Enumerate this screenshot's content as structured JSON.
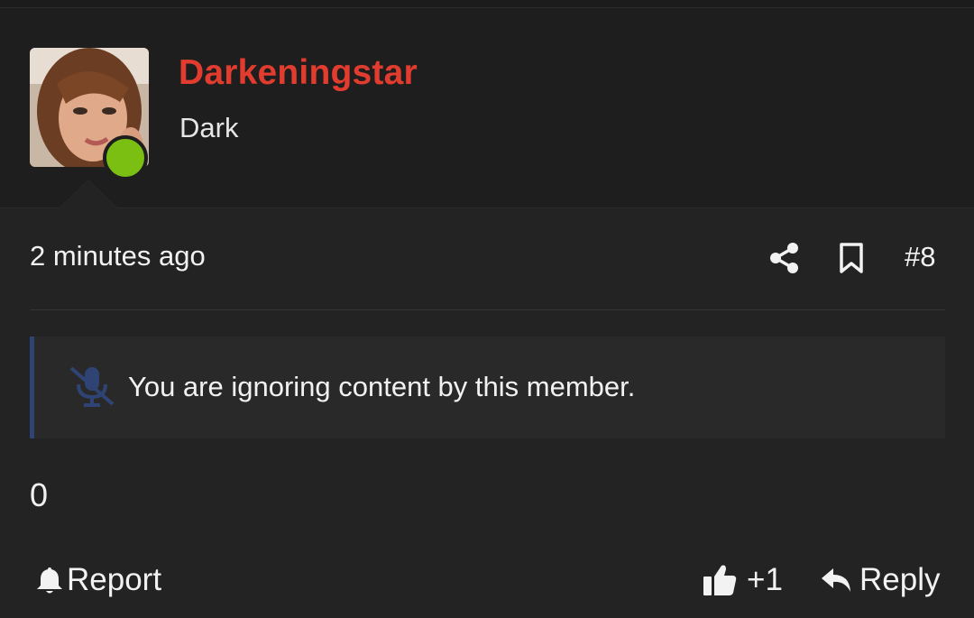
{
  "user": {
    "name": "Darkeningstar",
    "title": "Dark",
    "status": "online"
  },
  "post": {
    "time": "2 minutes ago",
    "number": "#8",
    "ignored_notice": "You are ignoring content by this member.",
    "reaction_score": "0"
  },
  "actions": {
    "report_label": "Report",
    "like_label": "+1",
    "reply_label": "Reply"
  },
  "icons": {
    "share": "share-icon",
    "bookmark": "bookmark-icon",
    "mute": "microphone-slash-icon",
    "report": "bell-icon",
    "like": "thumbs-up-icon",
    "reply": "reply-arrow-icon"
  },
  "colors": {
    "username": "#e23c2f",
    "online": "#7bbf12",
    "ignored_accent": "#2f4474",
    "background": "#232323"
  }
}
